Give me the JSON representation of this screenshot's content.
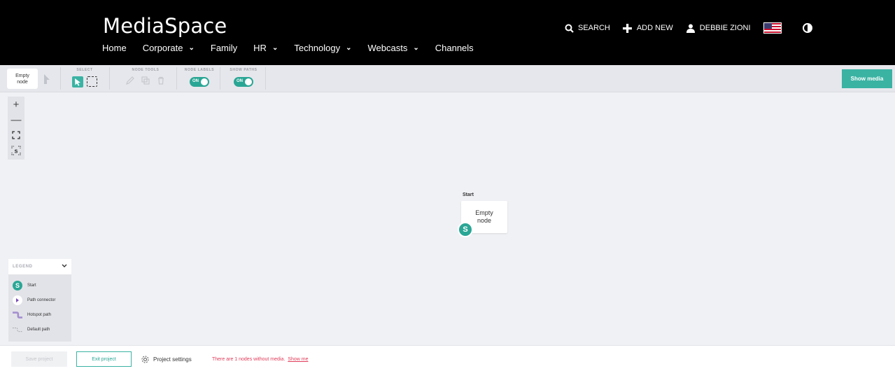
{
  "header": {
    "brand": "MediaSpace",
    "nav": [
      {
        "label": "Home",
        "dropdown": false
      },
      {
        "label": "Corporate",
        "dropdown": true
      },
      {
        "label": "Family",
        "dropdown": false
      },
      {
        "label": "HR",
        "dropdown": true
      },
      {
        "label": "Technology",
        "dropdown": true
      },
      {
        "label": "Webcasts",
        "dropdown": true
      },
      {
        "label": "Channels",
        "dropdown": false
      }
    ],
    "search_label": "SEARCH",
    "add_new_label": "ADD NEW",
    "user_name": "DEBBIE ZIONI"
  },
  "toolbar": {
    "node_chip": {
      "line1": "Empty",
      "line2": "node"
    },
    "select_label": "SELECT",
    "node_tools_label": "NODE TOOLS",
    "node_labels_label": "NODE LABELS",
    "node_labels_toggle": "ON",
    "show_paths_label": "SHOW PATHS",
    "show_paths_toggle": "ON",
    "show_media_label": "Show media"
  },
  "zoom": {
    "plus": "+",
    "minus": "—"
  },
  "canvas": {
    "start_label": "Start",
    "node_line1": "Empty",
    "node_line2": "node",
    "badge": "S"
  },
  "legend": {
    "title": "LEGEND",
    "items": [
      {
        "icon": "S",
        "label": "Start"
      },
      {
        "label": "Path connector"
      },
      {
        "label": "Hotspot path"
      },
      {
        "label": "Default path"
      }
    ]
  },
  "footer": {
    "save_label": "Save project",
    "exit_label": "Exit project",
    "settings_label": "Project settings",
    "warning_text": "There are 1 nodes without media.",
    "warning_link": "Show me"
  },
  "colors": {
    "accent": "#3bb3a3",
    "header_bg": "#000000",
    "warning": "#e03c5a",
    "legend_connector": "#7a4bb6",
    "hotspot_path": "#a48fcf"
  }
}
